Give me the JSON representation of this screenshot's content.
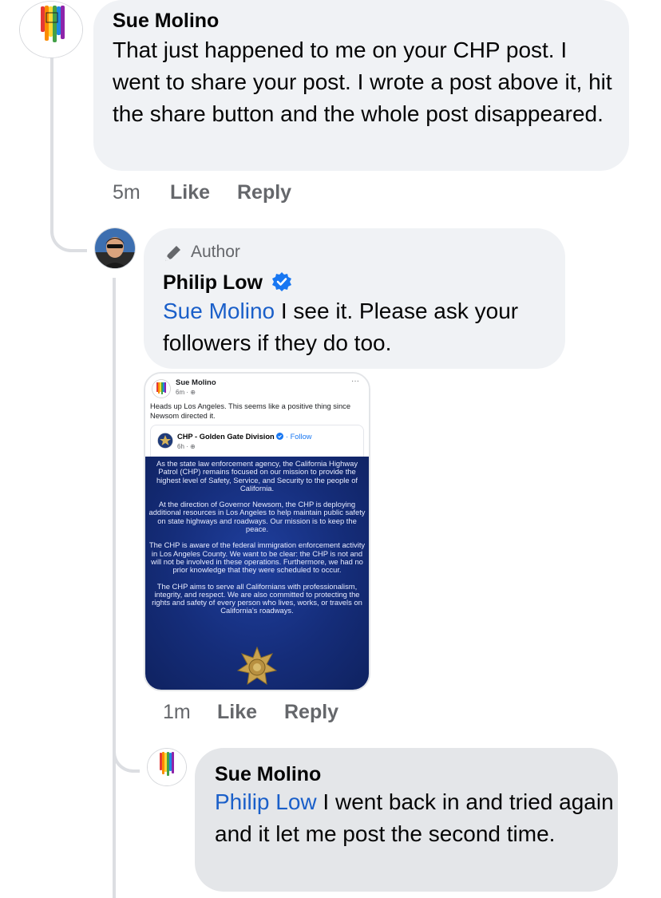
{
  "comment1": {
    "author": "Sue Molino",
    "text": "That just happened to me on your CHP post. I went to share your post. I wrote a post above it, hit the share button and the whole post disappeared.",
    "time": "5m",
    "like": "Like",
    "reply": "Reply"
  },
  "reply1": {
    "badge": "Author",
    "author": "Philip Low",
    "mention": "Sue Molino",
    "text": " I see it. Please ask your followers if they do too.",
    "time": "1m",
    "like": "Like",
    "reply": "Reply"
  },
  "embedded": {
    "poster": "Sue Molino",
    "poster_time": "6m · ",
    "post_text": "Heads up Los Angeles. This seems like a positive thing since Newsom directed it.",
    "page": "CHP - Golden Gate Division",
    "follow": "· Follow",
    "page_time": "6h · ",
    "menu": "···",
    "p1": "As the state law enforcement agency, the California Highway Patrol (CHP) remains focused on our mission to provide the highest level of Safety, Service, and Security to the people of California.",
    "p2": "At the direction of Governor Newsom, the CHP is deploying additional resources in Los Angeles to help maintain public safety on state highways and roadways. Our mission is to keep the peace.",
    "p3": "The CHP is aware of the federal immigration enforcement activity in Los Angeles County. We want to be clear: the CHP is not and will not be involved in these operations. Furthermore, we had no prior knowledge that they were scheduled to occur.",
    "p4": "The CHP aims to serve all Californians with professionalism, integrity, and respect. We are also committed to protecting the rights and safety of every person who lives, works, or travels on California's roadways."
  },
  "reply2": {
    "author": "Sue Molino",
    "mention": "Philip Low",
    "text": " I went back in and tried again and it let me post the second time."
  },
  "icons": [
    "rainbow-avatar",
    "profile-photo",
    "pen-icon",
    "verified-badge-icon",
    "globe-icon",
    "chp-badge-icon"
  ],
  "colors": {
    "mention": "#1a5fc9",
    "verified": "#1877f2",
    "bubble": "#f0f2f5",
    "muted": "#65676b"
  }
}
